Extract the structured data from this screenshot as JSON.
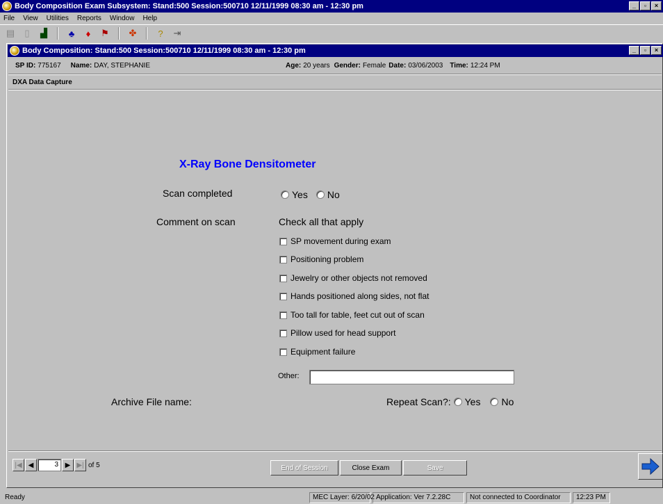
{
  "outer_window": {
    "title": "Body Composition Exam Subsystem: Stand:500 Session:500710 12/11/1999 08:30 am - 12:30 pm",
    "menu": [
      "File",
      "View",
      "Utilities",
      "Reports",
      "Window",
      "Help"
    ]
  },
  "inner_window": {
    "title": "Body Composition: Stand:500 Session:500710 12/11/1999 08:30 am - 12:30 pm"
  },
  "participant": {
    "sp_id_label": "SP ID:",
    "sp_id": "775167",
    "name_label": "Name:",
    "name": "DAY, STEPHANIE",
    "age_label": "Age:",
    "age": "20 years",
    "gender_label": "Gender:",
    "gender": "Female",
    "date_label": "Date:",
    "date": "03/06/2003",
    "time_label": "Time:",
    "time": "12:24 PM"
  },
  "section_title": "DXA Data Capture",
  "form": {
    "title": "X-Ray Bone Densitometer",
    "scan_completed_label": "Scan completed",
    "yes_label": "Yes",
    "no_label": "No",
    "comment_label": "Comment on scan",
    "check_all_label": "Check all that apply",
    "checkboxes": [
      "SP movement during exam",
      "Positioning problem",
      "Jewelry or other objects not removed",
      "Hands positioned along sides, not flat",
      "Too tall for table, feet cut out of scan",
      "Pillow used for head support",
      "Equipment failure"
    ],
    "other_label": "Other:",
    "other_value": "",
    "archive_label": "Archive File name:",
    "repeat_label": "Repeat Scan?:",
    "repeat_yes": "Yes",
    "repeat_no": "No"
  },
  "footer": {
    "page_current": "3",
    "page_total_label": "of 5",
    "buttons": [
      "End of Session",
      "Close Exam",
      "Save"
    ]
  },
  "statusbar": {
    "ready": "Ready",
    "mec_layer": "MEC Layer: 6/20/02",
    "application": "Application: Ver 7.2.28C",
    "coordinator": "Not connected to Coordinator",
    "clock": "12:23 PM"
  }
}
